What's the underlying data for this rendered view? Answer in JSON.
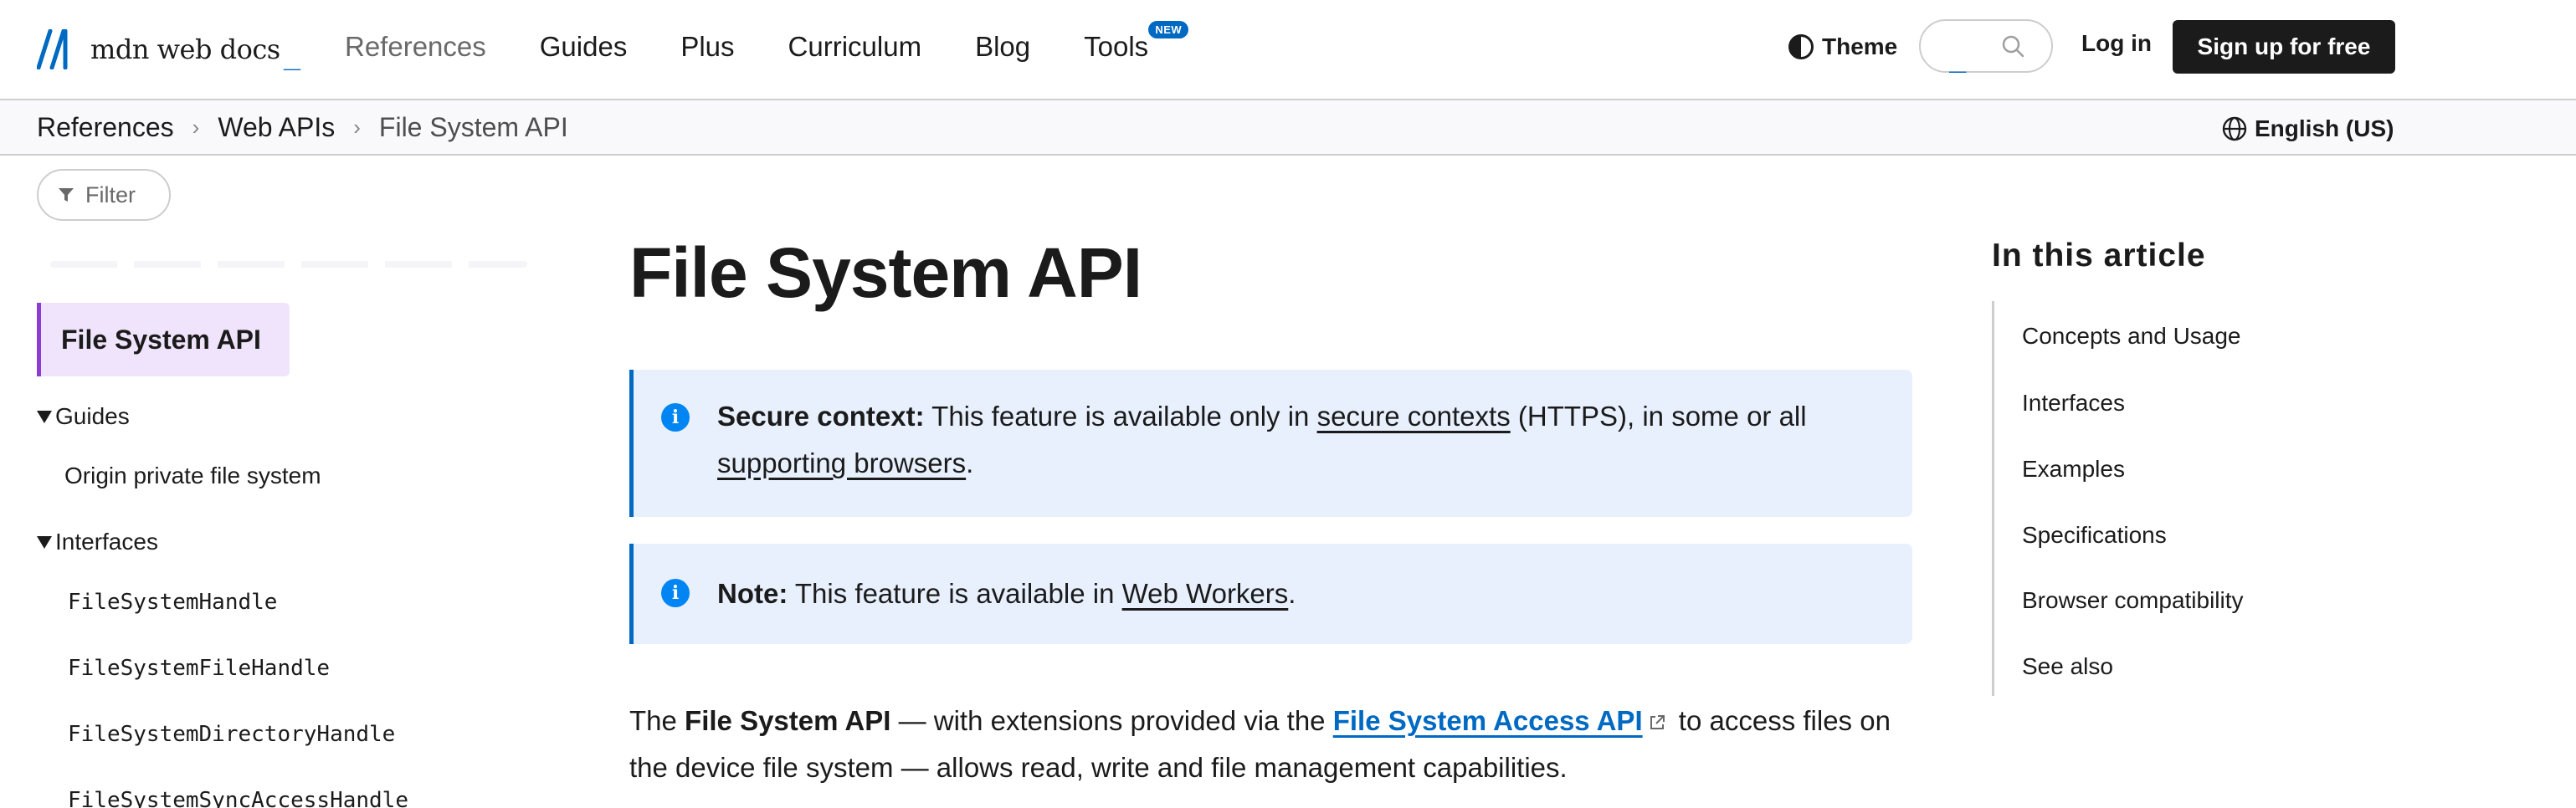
{
  "header": {
    "logo_text": "mdn web docs",
    "logo_cursor": "_",
    "nav": [
      {
        "label": "References",
        "active": true
      },
      {
        "label": "Guides"
      },
      {
        "label": "Plus"
      },
      {
        "label": "Curriculum"
      },
      {
        "label": "Blog"
      },
      {
        "label": "Tools",
        "badge": "NEW"
      }
    ],
    "theme_label": "Theme",
    "search_caret": "_",
    "login_label": "Log in",
    "signup_label": "Sign up for free"
  },
  "breadcrumb": {
    "items": [
      "References",
      "Web APIs",
      "File System API"
    ],
    "separator": "›"
  },
  "language": "English (US)",
  "sidebar": {
    "filter_placeholder": "Filter",
    "active_item": "File System API",
    "groups": [
      {
        "label": "Guides",
        "items": [
          "Origin private file system"
        ]
      },
      {
        "label": "Interfaces",
        "items": [
          "FileSystemHandle",
          "FileSystemFileHandle",
          "FileSystemDirectoryHandle",
          "FileSystemSyncAccessHandle"
        ]
      }
    ]
  },
  "main": {
    "title": "File System API",
    "notice_secure": {
      "label": "Secure context:",
      "text_a": " This feature is available only in ",
      "link_a": "secure contexts",
      "text_b": " (HTTPS), in some or all ",
      "link_b": "supporting browsers",
      "text_c": "."
    },
    "notice_note": {
      "label": "Note:",
      "text_a": " This feature is available in ",
      "link_a": "Web Workers",
      "text_b": "."
    },
    "intro": {
      "text_a": "The ",
      "bold_a": "File System API",
      "text_b": " — with extensions provided via the ",
      "link_a": "File System Access API",
      "text_c": " to access files on the device file system — allows read, write and file management capabilities."
    }
  },
  "toc": {
    "title": "In this article",
    "items": [
      "Concepts and Usage",
      "Interfaces",
      "Examples",
      "Specifications",
      "Browser compatibility",
      "See also"
    ]
  },
  "colors": {
    "brand_blue": "#0069c2",
    "active_purple": "#8b3cd3",
    "active_bg": "#efe4fb",
    "notice_bg": "#e8f0fe",
    "text": "#1b1b1b"
  }
}
